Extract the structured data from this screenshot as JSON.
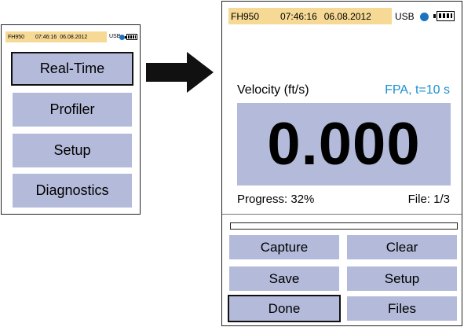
{
  "small_screen": {
    "status": {
      "device": "FH950",
      "time": "07:46:16",
      "date": "06.08.2012",
      "conn": "USB"
    },
    "menu": [
      {
        "label": "Real-Time",
        "selected": true
      },
      {
        "label": "Profiler",
        "selected": false
      },
      {
        "label": "Setup",
        "selected": false
      },
      {
        "label": "Diagnostics",
        "selected": false
      }
    ]
  },
  "large_screen": {
    "status": {
      "device": "FH950",
      "time": "07:46:16",
      "date": "06.08.2012",
      "conn": "USB"
    },
    "measurement_label": "Velocity (ft/s)",
    "mode_label": "FPA, t=10 s",
    "reading": "0.000",
    "progress_label": "Progress: 32%",
    "progress_value": 0.32,
    "file_label": "File: 1/3",
    "buttons": {
      "capture": "Capture",
      "clear": "Clear",
      "save": "Save",
      "setup": "Setup",
      "done": "Done",
      "files": "Files"
    }
  },
  "colors": {
    "status_bg": "#f6d995",
    "button_bg": "#b4bad9",
    "accent_blue": "#1a8fd0",
    "dot_blue": "#1a73c0"
  },
  "icons": [
    "arrow-right-icon",
    "status-dot-icon",
    "battery-icon"
  ]
}
